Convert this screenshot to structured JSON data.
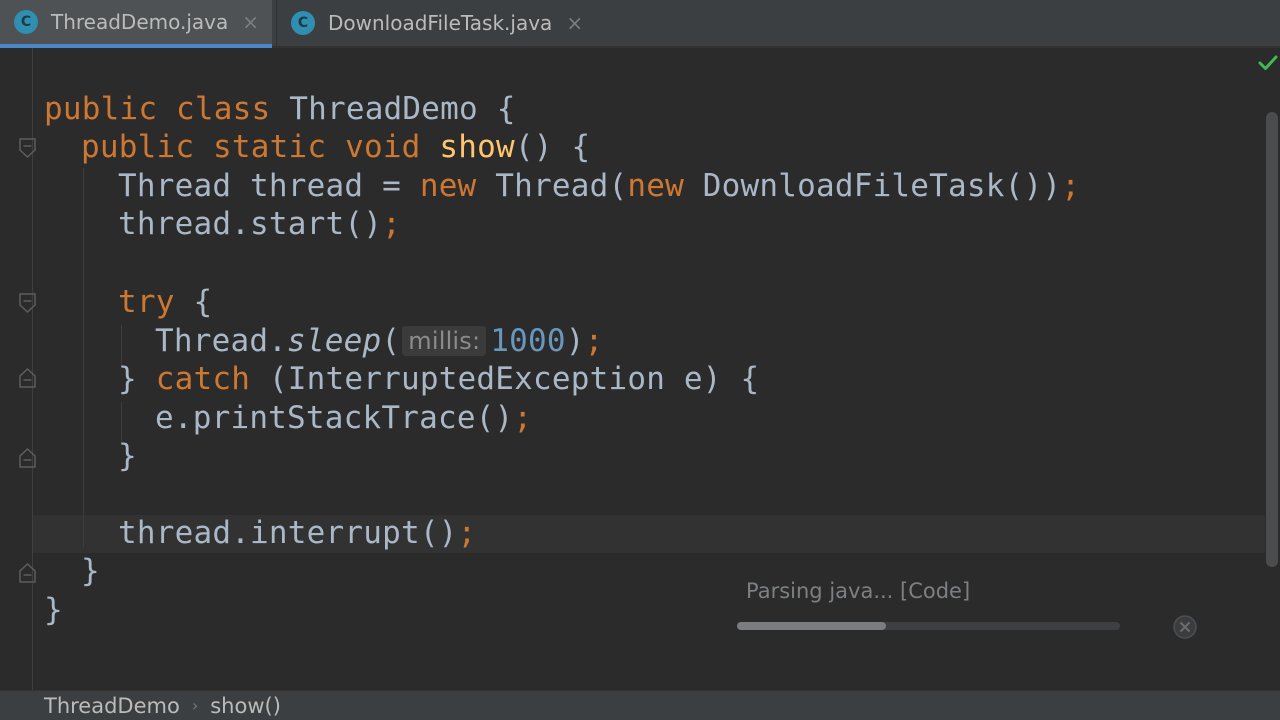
{
  "tabs": [
    {
      "icon": "class-icon",
      "icon_letter": "C",
      "label": "ThreadDemo.java",
      "active": true
    },
    {
      "icon": "class-icon",
      "icon_letter": "C",
      "label": "DownloadFileTask.java",
      "active": false
    }
  ],
  "tab_close_glyph": "×",
  "code": {
    "l1": {
      "kw": "public class ",
      "rest": "ThreadDemo {"
    },
    "l2": {
      "kw": "public static void ",
      "fn": "show",
      "rest": "() {"
    },
    "l3": {
      "a": "Thread thread = ",
      "kw1": "new",
      "b": " Thread(",
      "kw2": "new",
      "c": " DownloadFileTask())",
      "semi": ";"
    },
    "l4": {
      "a": "thread.start()",
      "semi": ";"
    },
    "l5": {
      "kw": "try",
      "rest": " {"
    },
    "l6": {
      "a": "Thread.",
      "it": "sleep",
      "b": "(",
      "hint": "millis:",
      "num": "1000",
      "c": ")",
      "semi": ";"
    },
    "l7": {
      "a": "} ",
      "kw": "catch",
      "b": " (InterruptedException e) {"
    },
    "l8": {
      "a": "e.printStackTrace()",
      "semi": ";"
    },
    "l9": {
      "a": "}"
    },
    "l10": {
      "a": "thread.interrupt()",
      "semi": ";"
    },
    "l11": {
      "a": "}"
    },
    "l12": {
      "a": "}"
    }
  },
  "progress": {
    "text": "Parsing java... [Code]",
    "fraction": 0.39
  },
  "breadcrumb": {
    "items": [
      "ThreadDemo",
      "show()"
    ],
    "separator": "›"
  },
  "colors": {
    "background": "#2b2b2b",
    "keyword": "#cc7832",
    "method": "#ffc66d",
    "number": "#6897bb",
    "text": "#a9b7c6",
    "check": "#3fb950"
  }
}
